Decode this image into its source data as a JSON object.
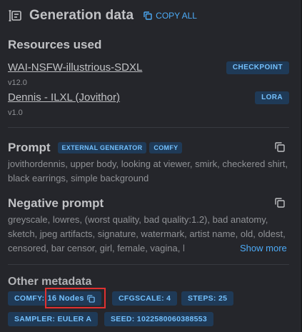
{
  "header": {
    "title": "Generation data",
    "copy_all_label": "COPY ALL"
  },
  "resources": {
    "title": "Resources used",
    "items": [
      {
        "name": "WAI-NSFW-illustrious-SDXL",
        "version": "v12.0",
        "type": "CHECKPOINT"
      },
      {
        "name": "Dennis - ILXL (Jovithor)",
        "version": "v1.0",
        "type": "LORA"
      }
    ]
  },
  "prompt": {
    "title": "Prompt",
    "badges": [
      "EXTERNAL GENERATOR",
      "COMFY"
    ],
    "text": "jovithordennis, upper body, looking at viewer, smirk, checkered shirt, black earrings, simple background"
  },
  "negative_prompt": {
    "title": "Negative prompt",
    "text": "greyscale, lowres, (worst quality, bad quality:1.2), bad anatomy, sketch, jpeg artifacts, signature, watermark, artist name, old, oldest, censored, bar censor, girl, female, vagina, l",
    "show_more": "Show more"
  },
  "metadata": {
    "title": "Other metadata",
    "comfy": {
      "label": "COMFY:",
      "nodes": "16 Nodes"
    },
    "cfg": "CFGSCALE: 4",
    "steps": "STEPS: 25",
    "sampler": "SAMPLER: EULER A",
    "seed": "SEED: 1022580060388553"
  },
  "colors": {
    "accent": "#4dabf7",
    "badge_bg": "#1f3a57",
    "highlight": "#e03131"
  }
}
